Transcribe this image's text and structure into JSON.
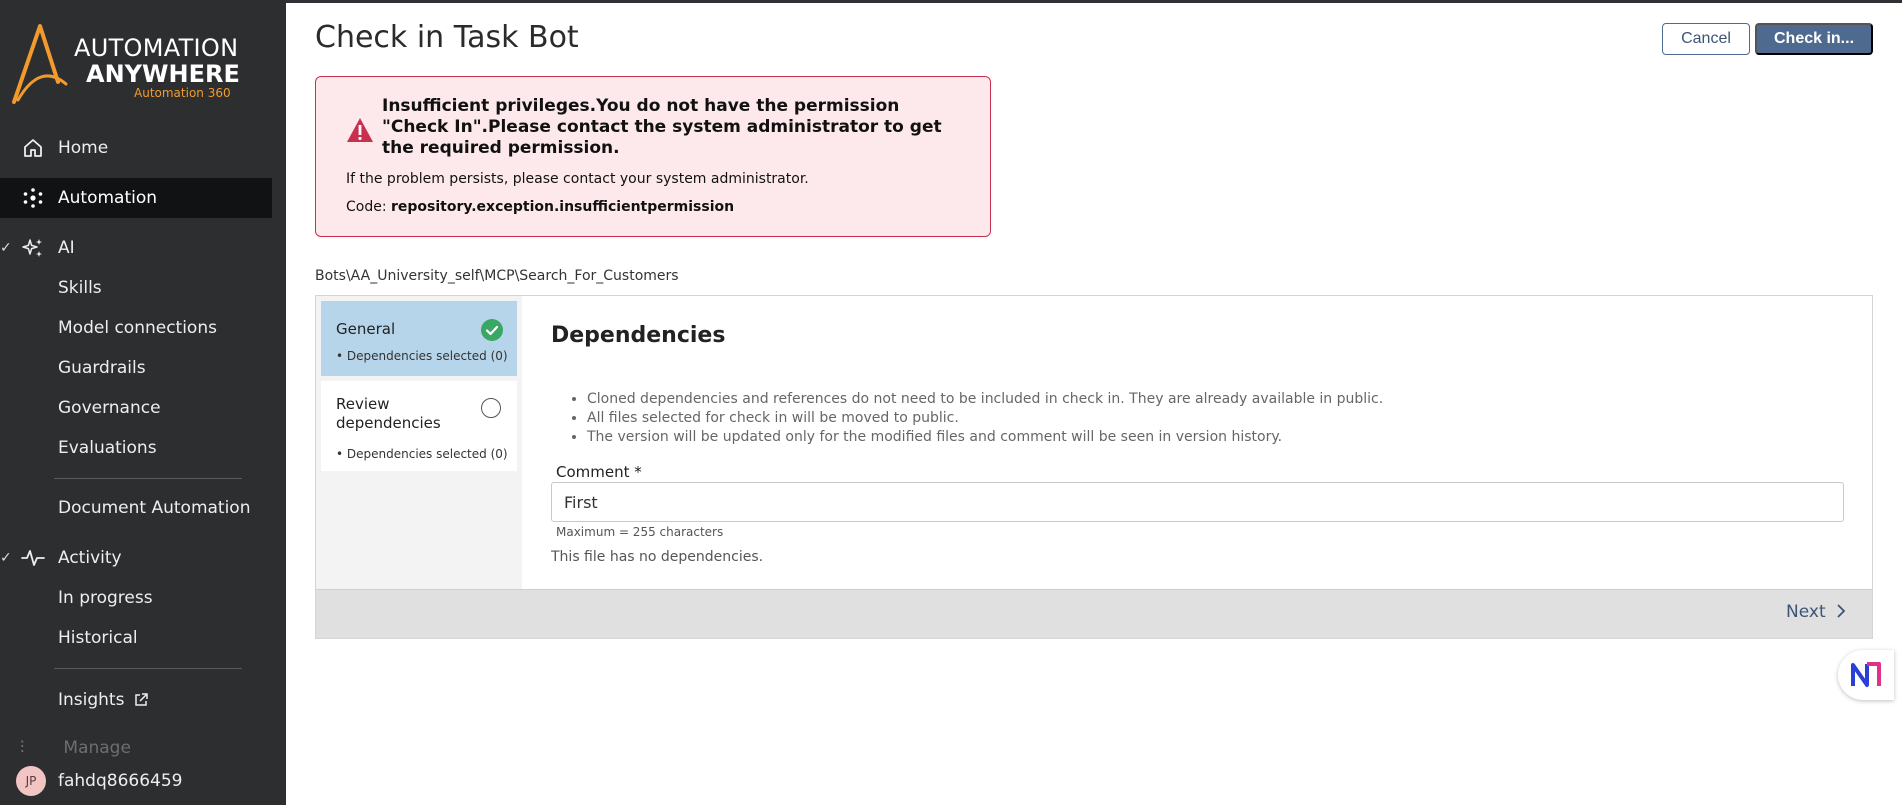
{
  "brand": {
    "line1": "AUTOMATION",
    "line2": "ANYWHERE",
    "tagline": "Automation 360",
    "accent": "#f39a2c"
  },
  "sidebar": {
    "items": [
      {
        "label": "Home",
        "icon": "home-icon"
      },
      {
        "label": "Automation",
        "icon": "automation-icon",
        "active": true
      },
      {
        "label": "AI",
        "icon": "sparkle-icon",
        "expanded": true
      },
      {
        "label": "Document Automation"
      },
      {
        "label": "Activity",
        "icon": "pulse-icon",
        "expanded": true
      },
      {
        "label": "Insights",
        "icon": "external-link-icon"
      }
    ],
    "ai_sub": [
      "Skills",
      "Model connections",
      "Guardrails",
      "Governance",
      "Evaluations"
    ],
    "activity_sub": [
      "In progress",
      "Historical"
    ],
    "faded_item": "Manage",
    "user": {
      "initials": "JP",
      "name": "fahdq8666459"
    }
  },
  "header": {
    "title": "Check in Task Bot",
    "cancel_label": "Cancel",
    "checkin_label": "Check in..."
  },
  "alert": {
    "title": "Insufficient privileges.You do not have the permission \"Check In\".Please contact the system administrator to get the required permission.",
    "message": "If the problem persists, please contact your system administrator.",
    "code_label": "Code: ",
    "code_value": "repository.exception.insufficientpermission",
    "color": "#c8304d"
  },
  "path": "Bots\\AA_University_self\\MCP\\Search_For_Customers",
  "steps": [
    {
      "title": "General",
      "sub": "• Dependencies selected (0)",
      "status": "done"
    },
    {
      "title": "Review dependencies",
      "sub": "• Dependencies selected (0)",
      "status": "todo"
    }
  ],
  "content": {
    "title": "Dependencies",
    "bullets": [
      "Cloned dependencies and references do not need to be included in check in. They are already available in public.",
      "All files selected for check in will be moved to public.",
      "The version will be updated only for the modified files and comment will be seen in version history."
    ],
    "comment_label": "Comment *",
    "comment_value": "First",
    "max_chars": "Maximum = 255 characters",
    "no_deps": "This file has no dependencies."
  },
  "footer": {
    "next_label": "Next"
  }
}
